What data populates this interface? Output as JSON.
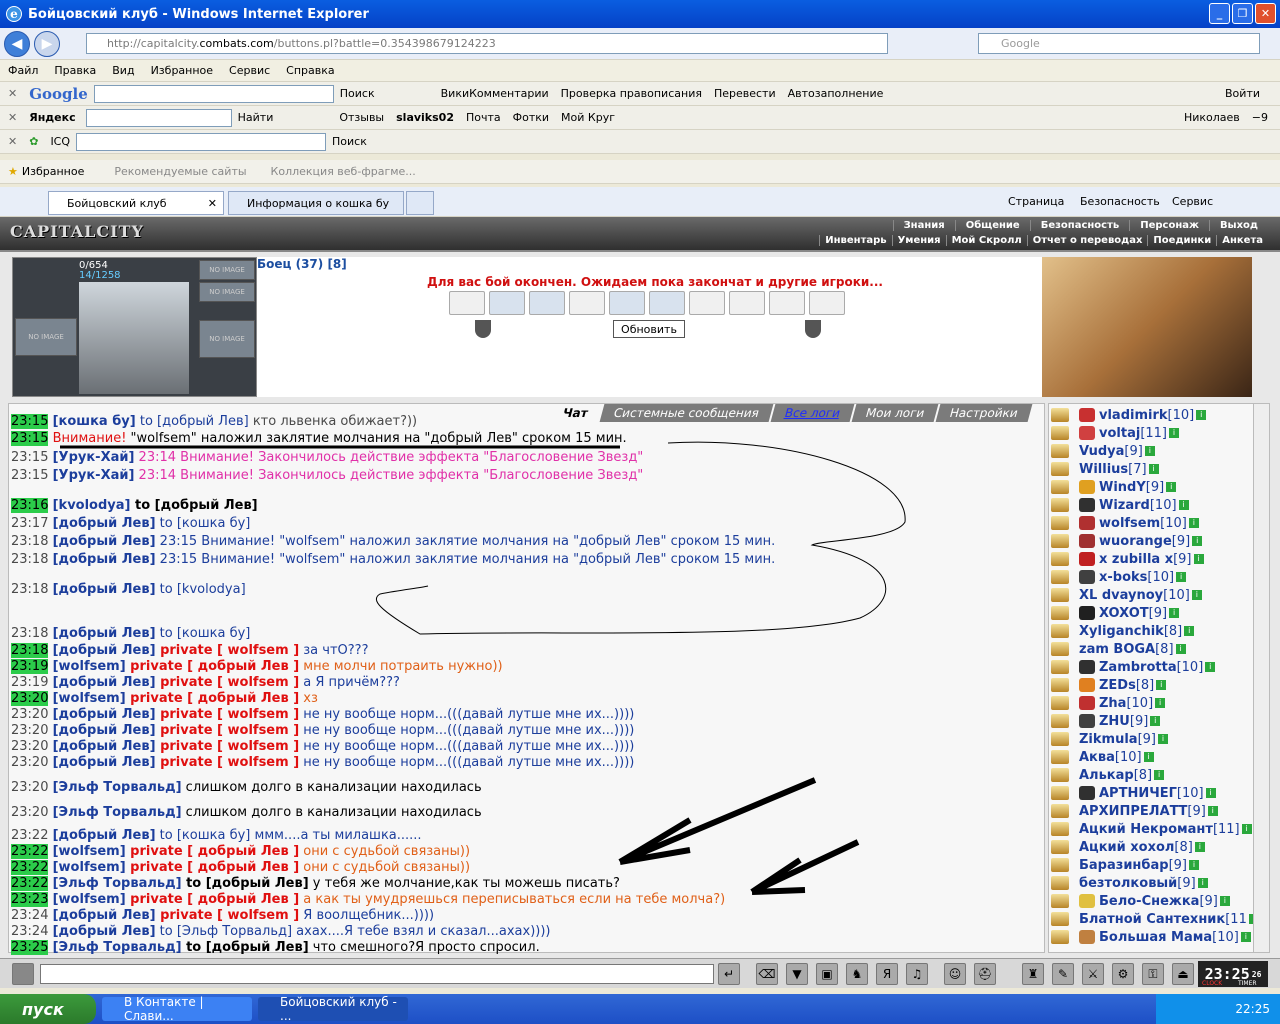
{
  "window": {
    "title": "Бойцовский клуб - Windows Internet Explorer"
  },
  "address": {
    "url_prefix": "http://capitalcity.",
    "url_domain": "combats.com",
    "url_suffix": "/buttons.pl?battle=0.354398679124223",
    "search_placeholder": "Google"
  },
  "menu": [
    "Файл",
    "Правка",
    "Вид",
    "Избранное",
    "Сервис",
    "Справка"
  ],
  "google_bar": {
    "logo": "Google",
    "items": [
      "Поиск",
      "ВикиКомментарии",
      "Проверка правописания",
      "Перевести",
      "Автозаполнение",
      "Войти"
    ]
  },
  "yandex_bar": {
    "logo": "Яндекс",
    "find": "Найти",
    "items": [
      "Отзывы",
      "slaviks02",
      "Почта",
      "Фотки",
      "Мой Круг"
    ],
    "city": "Николаев",
    "temp": "−9"
  },
  "icq_bar": {
    "label": "ICQ",
    "search": "Поиск"
  },
  "favorites": {
    "label": "Избранное",
    "items": [
      "Рекомендуемые сайты",
      "Коллекция веб-фрагме..."
    ]
  },
  "tabs": [
    {
      "label": "Бойцовский клуб"
    },
    {
      "label": "Информация о кошка бу"
    }
  ],
  "ie_cmd": [
    "Страница",
    "Безопасность",
    "Сервис"
  ],
  "game": {
    "logo": "CAPITALCITY",
    "topmenu": [
      "Знания",
      "Общение",
      "Безопасность",
      "Персонаж",
      "Выход"
    ],
    "submenu": [
      "Инвентарь",
      "Умения",
      "Мой Скролл",
      "Отчет о переводах",
      "Поединки",
      "Анкета"
    ],
    "hp": "0/654",
    "mana": "14/1258",
    "no_image": "NO IMAGE",
    "fighter": "Боец (37) [8]",
    "alert": "Для вас бой окончен. Ожидаем пока закончат и другие игроки...",
    "refresh": "Обновить"
  },
  "chat_tabs": [
    "Чат",
    "Системные сообщения",
    "Все логи",
    "Мои логи",
    "Настройки"
  ],
  "messages": [
    {
      "time": "23:15",
      "hl": true,
      "parts": [
        [
          "n",
          "[кошка бу]"
        ],
        [
          "to",
          " to [добрый Лев]"
        ],
        [
          "t",
          " кто львенка обижает?))"
        ]
      ]
    },
    {
      "time": "23:15",
      "hl": true,
      "parts": [
        [
          "red",
          "Внимание!"
        ],
        [
          "blk",
          " \"wolfsem\" наложил заклятие молчания на \"добрый Лев\" сроком 15 мин."
        ]
      ]
    },
    {
      "time": "23:15",
      "hl": false,
      "parts": [
        [
          "n",
          "[Урук-Хай]"
        ],
        [
          "pink",
          " 23:14 Внимание! Закончилось действие эффекта \"Благословение Звезд\""
        ]
      ]
    },
    {
      "time": "23:15",
      "hl": false,
      "parts": [
        [
          "n",
          "[Урук-Хай]"
        ],
        [
          "pink",
          " 23:14 Внимание! Закончилось действие эффекта \"Благословение Звезд\""
        ]
      ]
    },
    {
      "time": "23:16",
      "hl": true,
      "parts": [
        [
          "n",
          "[kvolodya]"
        ],
        [
          "blkb",
          " to [добрый Лев]"
        ]
      ]
    },
    {
      "time": "23:17",
      "hl": false,
      "parts": [
        [
          "n",
          "[добрый Лев]"
        ],
        [
          "to",
          " to [кошка бу]"
        ]
      ]
    },
    {
      "time": "23:18",
      "hl": false,
      "parts": [
        [
          "n",
          "[добрый Лев]"
        ],
        [
          "navy",
          " 23:15 Внимание! \"wolfsem\" наложил заклятие молчания на \"добрый Лев\" сроком 15 мин."
        ]
      ]
    },
    {
      "time": "23:18",
      "hl": false,
      "parts": [
        [
          "n",
          "[добрый Лев]"
        ],
        [
          "navy",
          " 23:15 Внимание! \"wolfsem\" наложил заклятие молчания на \"добрый Лев\" сроком 15 мин."
        ]
      ]
    },
    {
      "time": "23:18",
      "hl": false,
      "parts": [
        [
          "n",
          "[добрый Лев]"
        ],
        [
          "to",
          " to [kvolodya]"
        ]
      ]
    },
    {
      "time": "23:18",
      "hl": false,
      "parts": [
        [
          "n",
          "[добрый Лев]"
        ],
        [
          "to",
          " to [кошка бу]"
        ]
      ]
    },
    {
      "time": "23:18",
      "hl": true,
      "parts": [
        [
          "n",
          "[добрый Лев]"
        ],
        [
          "priv",
          " private [ wolfsem ]"
        ],
        [
          "navy",
          " за чтО???"
        ]
      ]
    },
    {
      "time": "23:19",
      "hl": true,
      "parts": [
        [
          "n",
          "[wolfsem]"
        ],
        [
          "priv",
          " private [ добрый Лев ]"
        ],
        [
          "orng",
          " мне молчи потраить нужно))"
        ]
      ]
    },
    {
      "time": "23:19",
      "hl": false,
      "parts": [
        [
          "n",
          "[добрый Лев]"
        ],
        [
          "priv",
          " private [ wolfsem ]"
        ],
        [
          "navy",
          " а Я причём???"
        ]
      ]
    },
    {
      "time": "23:20",
      "hl": true,
      "parts": [
        [
          "n",
          "[wolfsem]"
        ],
        [
          "priv",
          " private [ добрый Лев ]"
        ],
        [
          "orng",
          " хз"
        ]
      ]
    },
    {
      "time": "23:20",
      "hl": false,
      "parts": [
        [
          "n",
          "[добрый Лев]"
        ],
        [
          "priv",
          " private [ wolfsem ]"
        ],
        [
          "navy",
          " не ну вообще норм...(((давай лутше мне их...))))"
        ]
      ]
    },
    {
      "time": "23:20",
      "hl": false,
      "parts": [
        [
          "n",
          "[добрый Лев]"
        ],
        [
          "priv",
          " private [ wolfsem ]"
        ],
        [
          "navy",
          " не ну вообще норм...(((давай лутше мне их...))))"
        ]
      ]
    },
    {
      "time": "23:20",
      "hl": false,
      "parts": [
        [
          "n",
          "[добрый Лев]"
        ],
        [
          "priv",
          " private [ wolfsem ]"
        ],
        [
          "navy",
          " не ну вообще норм...(((давай лутше мне их...))))"
        ]
      ]
    },
    {
      "time": "23:20",
      "hl": false,
      "parts": [
        [
          "n",
          "[добрый Лев]"
        ],
        [
          "priv",
          " private [ wolfsem ]"
        ],
        [
          "navy",
          " не ну вообще норм...(((давай лутше мне их...))))"
        ]
      ]
    },
    {
      "time": "23:20",
      "hl": false,
      "parts": [
        [
          "n",
          "[Эльф Торвальд]"
        ],
        [
          "blk",
          "                 слишком долго в канализации находилась"
        ]
      ]
    },
    {
      "time": "23:20",
      "hl": false,
      "parts": [
        [
          "n",
          "[Эльф Торвальд]"
        ],
        [
          "blk",
          "                 слишком долго в канализации находилась"
        ]
      ]
    },
    {
      "time": "23:22",
      "hl": false,
      "parts": [
        [
          "n",
          "[добрый Лев]"
        ],
        [
          "to",
          " to [кошка бу]"
        ],
        [
          "navy",
          " ммм....а ты милашка......"
        ]
      ]
    },
    {
      "time": "23:22",
      "hl": true,
      "parts": [
        [
          "n",
          "[wolfsem]"
        ],
        [
          "priv",
          " private [ добрый Лев ]"
        ],
        [
          "orng",
          " они с судьбой связаны))"
        ]
      ]
    },
    {
      "time": "23:22",
      "hl": true,
      "parts": [
        [
          "n",
          "[wolfsem]"
        ],
        [
          "priv",
          " private [ добрый Лев ]"
        ],
        [
          "orng",
          " они с судьбой связаны))"
        ]
      ]
    },
    {
      "time": "23:22",
      "hl": true,
      "parts": [
        [
          "n",
          "[Эльф Торвальд]"
        ],
        [
          "blkb",
          " to [добрый Лев]"
        ],
        [
          "blk",
          " у тебя же молчание,как ты можешь писать?"
        ]
      ]
    },
    {
      "time": "23:23",
      "hl": true,
      "parts": [
        [
          "n",
          "[wolfsem]"
        ],
        [
          "priv",
          " private [ добрый Лев ]"
        ],
        [
          "orng",
          " а как ты умудряешься переписываться если на тебе молча?)"
        ]
      ]
    },
    {
      "time": "23:24",
      "hl": false,
      "parts": [
        [
          "n",
          "[добрый Лев]"
        ],
        [
          "priv",
          " private [ wolfsem ]"
        ],
        [
          "navy",
          " Я воолщебник...))))"
        ]
      ]
    },
    {
      "time": "23:24",
      "hl": false,
      "parts": [
        [
          "n",
          "[добрый Лев]"
        ],
        [
          "to",
          " to [Эльф Торвальд]"
        ],
        [
          "navy",
          " ахах....Я тебе взял и сказал...ахах))))"
        ]
      ]
    },
    {
      "time": "23:25",
      "hl": true,
      "parts": [
        [
          "n",
          "[Эльф Торвальд]"
        ],
        [
          "blkb",
          " to [добрый Лев]"
        ],
        [
          "blk",
          " что смешного?Я просто спросил."
        ]
      ]
    }
  ],
  "users": [
    {
      "name": "vladimirk",
      "lvl": "[10]",
      "clan": "#c83030"
    },
    {
      "name": "voltaj",
      "lvl": "[11]",
      "clan": "#d04040"
    },
    {
      "name": "Vudya",
      "lvl": "[9]",
      "clan": ""
    },
    {
      "name": "Willius",
      "lvl": "[7]",
      "clan": ""
    },
    {
      "name": "WindY",
      "lvl": "[9]",
      "clan": "#e0a020"
    },
    {
      "name": "Wizard",
      "lvl": "[10]",
      "clan": "#303030"
    },
    {
      "name": "wolfsem",
      "lvl": "[10]",
      "clan": "#b03030"
    },
    {
      "name": "wuorange",
      "lvl": "[9]",
      "clan": "#a03030"
    },
    {
      "name": "x zubilla x",
      "lvl": "[9]",
      "clan": "#c02020"
    },
    {
      "name": "x-boks",
      "lvl": "[10]",
      "clan": "#404040"
    },
    {
      "name": "XL dvaynoy",
      "lvl": "[10]",
      "clan": ""
    },
    {
      "name": "XOXOT",
      "lvl": "[9]",
      "clan": "#202020"
    },
    {
      "name": "Xyliganchik",
      "lvl": "[8]",
      "clan": ""
    },
    {
      "name": "zam BOGA",
      "lvl": "[8]",
      "clan": ""
    },
    {
      "name": "Zambrotta",
      "lvl": "[10]",
      "clan": "#303030"
    },
    {
      "name": "ZEDs",
      "lvl": "[8]",
      "clan": "#e08020"
    },
    {
      "name": "Zha",
      "lvl": "[10]",
      "clan": "#c03030"
    },
    {
      "name": "ZHU",
      "lvl": "[9]",
      "clan": "#404040"
    },
    {
      "name": "Zikmula",
      "lvl": "[9]",
      "clan": ""
    },
    {
      "name": "Аква",
      "lvl": "[10]",
      "clan": ""
    },
    {
      "name": "Алькар",
      "lvl": "[8]",
      "clan": ""
    },
    {
      "name": "АРТНИЧЕГ",
      "lvl": "[10]",
      "clan": "#303030"
    },
    {
      "name": "АРХИПРЕЛАТТ",
      "lvl": "[9]",
      "clan": ""
    },
    {
      "name": "Ацкий Некромант",
      "lvl": "[11]",
      "clan": ""
    },
    {
      "name": "Ацкий хохол",
      "lvl": "[8]",
      "clan": ""
    },
    {
      "name": "Баразинбар",
      "lvl": "[9]",
      "clan": ""
    },
    {
      "name": "безтолковый",
      "lvl": "[9]",
      "clan": ""
    },
    {
      "name": "Бело-Снежка",
      "lvl": "[9]",
      "clan": "#e0c040"
    },
    {
      "name": "Блатной Сантехник",
      "lvl": "[11",
      "clan": ""
    },
    {
      "name": "Большая Мама",
      "lvl": "[10]",
      "clan": "#c08040"
    }
  ],
  "bottom": {
    "clock": "23:25",
    "clock_sec": "26",
    "clock_label": "CLOCK",
    "timer_label": "TIMER"
  },
  "taskbar": {
    "start": "пуск",
    "tasks": [
      "В Контакте | Слави...",
      "Бойцовский клуб - ..."
    ],
    "time": "22:25"
  }
}
